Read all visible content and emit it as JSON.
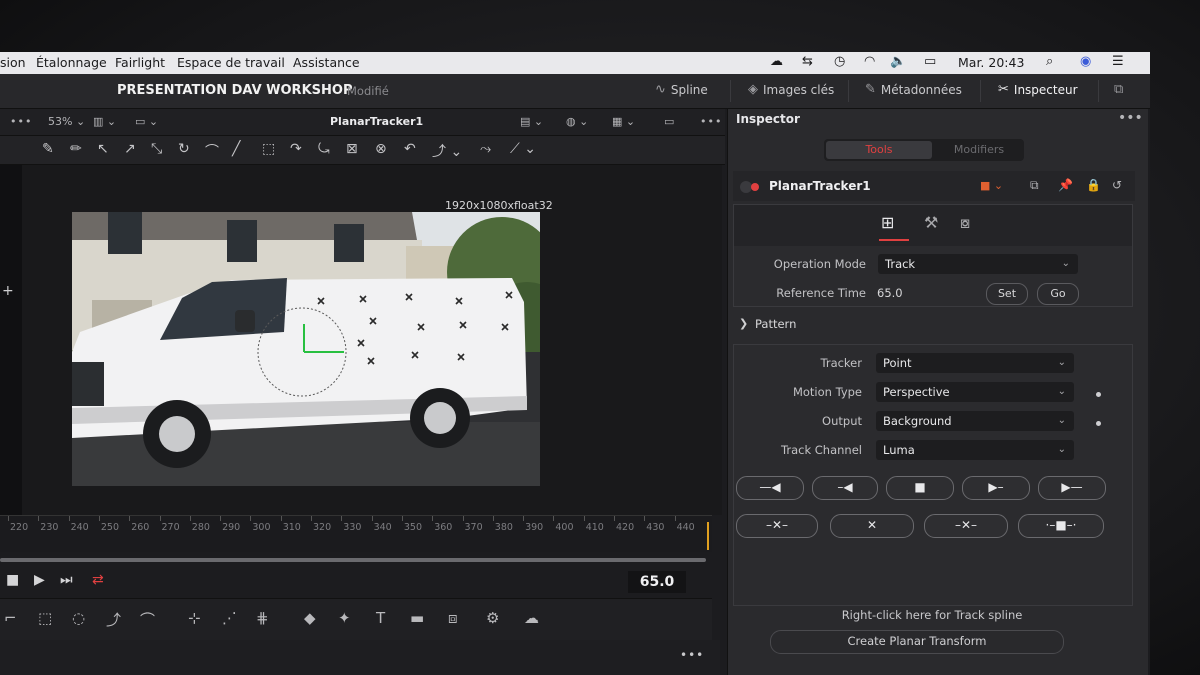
{
  "menubar": {
    "items": [
      "sion",
      "Étalonnage",
      "Fairlight",
      "Espace de travail",
      "Assistance"
    ],
    "clock": "Mar. 20:43"
  },
  "header": {
    "project_title": "PRESENTATION DAV WORKSHOP",
    "status": "Modifié",
    "buttons": [
      "Spline",
      "Images clés",
      "Métadonnées",
      "Inspecteur"
    ]
  },
  "viewer": {
    "zoom": "53%",
    "clip_name": "PlanarTracker1",
    "resolution": "1920x1080xfloat32",
    "timecode": "65.0"
  },
  "timeline": {
    "ticks": [
      "220",
      "230",
      "240",
      "250",
      "260",
      "270",
      "280",
      "290",
      "300",
      "310",
      "320",
      "330",
      "340",
      "350",
      "360",
      "370",
      "380",
      "390",
      "400",
      "410",
      "420",
      "430",
      "440"
    ]
  },
  "inspector": {
    "title": "Inspector",
    "tabs": [
      "Tools",
      "Modifiers"
    ],
    "node_name": "PlanarTracker1",
    "operation_mode_label": "Operation Mode",
    "operation_mode_value": "Track",
    "reference_time_label": "Reference Time",
    "reference_time_value": "65.0",
    "set_label": "Set",
    "go_label": "Go",
    "pattern_label": "Pattern",
    "tracker_label": "Tracker",
    "tracker_value": "Point",
    "motion_type_label": "Motion Type",
    "motion_type_value": "Perspective",
    "output_label": "Output",
    "output_value": "Background",
    "track_channel_label": "Track Channel",
    "track_channel_value": "Luma",
    "right_click_hint": "Right-click here for Track spline",
    "create_planar_label": "Create Planar Transform"
  },
  "colors": {
    "accent": "#e04040",
    "playhead": "#e0a020",
    "panel": "#2a2a2d"
  }
}
